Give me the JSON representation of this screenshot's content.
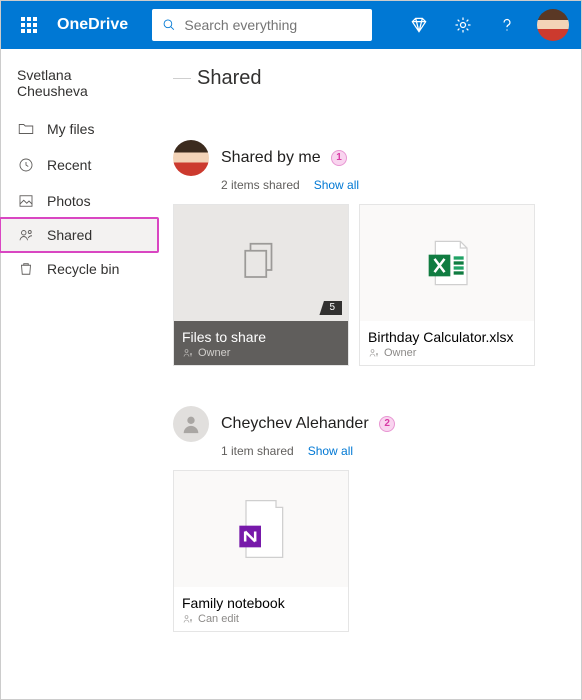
{
  "header": {
    "brand": "OneDrive",
    "search_placeholder": "Search everything"
  },
  "user": {
    "name": "Svetlana Cheusheva"
  },
  "nav": {
    "my_files": "My files",
    "recent": "Recent",
    "photos": "Photos",
    "shared": "Shared",
    "recycle": "Recycle bin"
  },
  "page": {
    "title": "Shared"
  },
  "sections": {
    "byme": {
      "title": "Shared by me",
      "badge": "1",
      "subtitle": "2 items shared",
      "show_all": "Show all",
      "tiles": {
        "folder": {
          "name": "Files to share",
          "count": "5",
          "perm": "Owner"
        },
        "excel": {
          "name": "Birthday Calculator.xlsx",
          "perm": "Owner"
        }
      }
    },
    "other": {
      "title": "Cheychev Alehander",
      "badge": "2",
      "subtitle": "1 item shared",
      "show_all": "Show all",
      "tiles": {
        "note": {
          "name": "Family notebook",
          "perm": "Can edit"
        }
      }
    }
  }
}
